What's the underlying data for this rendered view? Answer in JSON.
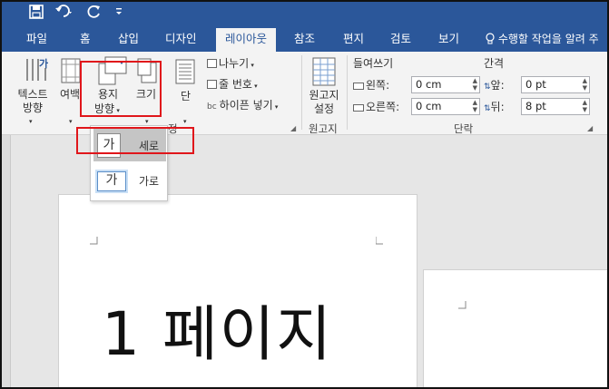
{
  "qat": {
    "save_icon": "save-icon",
    "undo_icon": "undo-icon",
    "redo_icon": "redo-icon",
    "customize_icon": "customize-icon"
  },
  "tabs": [
    {
      "label": "파일"
    },
    {
      "label": "홈"
    },
    {
      "label": "삽입"
    },
    {
      "label": "디자인"
    },
    {
      "label": "레이아웃"
    },
    {
      "label": "참조"
    },
    {
      "label": "편지"
    },
    {
      "label": "검토"
    },
    {
      "label": "보기"
    }
  ],
  "tell_me": "수행할 작업을 알려 주",
  "ribbon": {
    "text_direction": [
      "텍스트",
      "방향"
    ],
    "margins": "여백",
    "orientation": [
      "용지",
      "방향"
    ],
    "size": "크기",
    "columns": "단",
    "breaks": "나누기",
    "line_numbers": "줄 번호",
    "hyphenation": "하이픈 넣기",
    "manuscript": [
      "원고지",
      "설정"
    ],
    "manuscript_group": "원고지",
    "indent_title": "들여쓰기",
    "indent_left_label": "왼쪽:",
    "indent_left_value": "0 cm",
    "indent_right_label": "오른쪽:",
    "indent_right_value": "0 cm",
    "spacing_title": "간격",
    "spacing_before_label": "앞:",
    "spacing_before_value": "0 pt",
    "spacing_after_label": "뒤:",
    "spacing_after_value": "8 pt",
    "paragraph_group": "단락",
    "page_setup_group_tail": "정"
  },
  "dropdown": {
    "items": [
      {
        "icon_text": "가",
        "label": "세로",
        "selected": true
      },
      {
        "icon_text": "가",
        "label": "가로",
        "selected": false
      }
    ]
  },
  "document": {
    "page1_text": "1 페이지"
  },
  "colors": {
    "accent": "#2b579a",
    "highlight": "#e0161b"
  }
}
